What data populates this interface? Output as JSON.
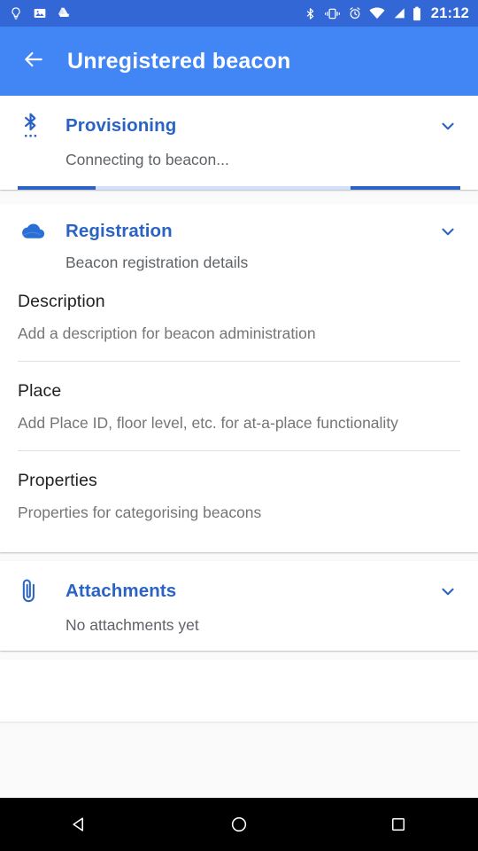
{
  "status_bar": {
    "background": "#3367d6",
    "time": "21:12",
    "left_icons": [
      {
        "name": "lightbulb-icon",
        "label": "Tips"
      },
      {
        "name": "photos-icon",
        "label": "Photos"
      },
      {
        "name": "google-drive-icon",
        "label": "Drive"
      }
    ],
    "right_icons": [
      {
        "name": "bluetooth-icon",
        "label": "Bluetooth"
      },
      {
        "name": "vibrate-icon",
        "label": "Vibrate"
      },
      {
        "name": "alarm-icon",
        "label": "Alarm"
      },
      {
        "name": "wifi-icon",
        "label": "Wi-Fi"
      },
      {
        "name": "cell-signal-icon",
        "label": "Signal"
      },
      {
        "name": "battery-icon",
        "label": "Battery"
      }
    ]
  },
  "app_bar": {
    "background": "#4285f4",
    "back_icon": "arrow-back-icon",
    "title": "Unregistered beacon"
  },
  "accent_color": "#2a63c4",
  "cards": {
    "provisioning": {
      "icon": "bluetooth-searching-icon",
      "title": "Provisioning",
      "subtitle": "Connecting to beacon...",
      "chevron": "chevron-down-icon",
      "progress": {
        "indeterminate": true,
        "track_color": "#d3e0fb",
        "bar_color": "#2a63c4",
        "segments": [
          {
            "start_pct": 0,
            "width_pct": 17.6
          },
          {
            "start_pct": 75.2,
            "width_pct": 24.8
          }
        ]
      }
    },
    "registration": {
      "icon": "cloud-icon",
      "title": "Registration",
      "subtitle": "Beacon registration details",
      "chevron": "chevron-down-icon",
      "fields": [
        {
          "label": "Description",
          "value": "Add a description for beacon administration",
          "divider": true
        },
        {
          "label": "Place",
          "value": "Add Place ID, floor level, etc. for at-a-place functionality",
          "divider": true
        },
        {
          "label": "Properties",
          "value": "Properties for categorising beacons",
          "divider": false
        }
      ]
    },
    "attachments": {
      "icon": "attachment-icon",
      "title": "Attachments",
      "subtitle": "No attachments yet",
      "chevron": "chevron-down-icon"
    }
  },
  "nav_bar": {
    "background": "#000000",
    "buttons": [
      {
        "name": "nav-back-button",
        "label": "Back"
      },
      {
        "name": "nav-home-button",
        "label": "Home"
      },
      {
        "name": "nav-recents-button",
        "label": "Recents"
      }
    ]
  }
}
